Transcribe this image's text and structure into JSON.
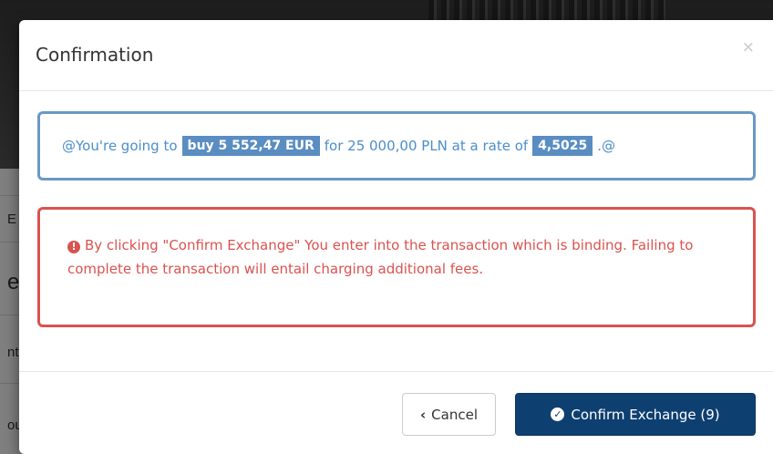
{
  "background": {
    "fragments": [
      "E",
      "e",
      "nt",
      "ou"
    ]
  },
  "modal": {
    "title": "Confirmation",
    "close_label": "×",
    "info": {
      "prefix": "@You're going to",
      "action_highlight": "buy 5 552,47 EUR",
      "middle": "for 25 000,00 PLN at a rate of",
      "rate_highlight": "4,5025",
      "suffix": ".@"
    },
    "warning": {
      "icon": "exclamation-circle-icon",
      "text": "By clicking \"Confirm Exchange\" You enter into the transaction which is binding. Failing to complete the transaction will entail charging additional fees."
    },
    "footer": {
      "cancel_icon": "chevron-left-icon",
      "cancel_label": "Cancel",
      "confirm_icon": "check-circle-icon",
      "confirm_label": "Confirm Exchange (9)"
    }
  },
  "colors": {
    "info_border": "#6b98c5",
    "info_text": "#4b8ec9",
    "highlight_bg": "#5a8dc2",
    "danger": "#d9534f",
    "primary_button": "#0e3f71"
  }
}
